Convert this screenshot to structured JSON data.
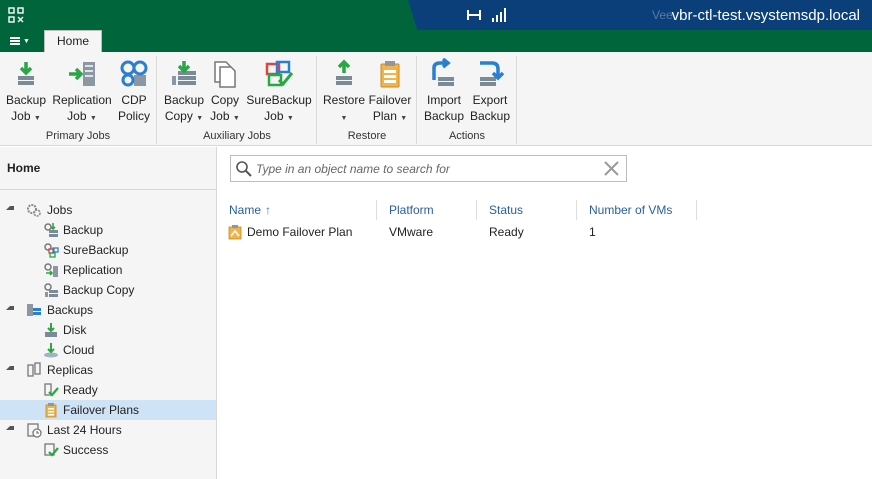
{
  "window": {
    "server_name": "vbr-ctl-test.vsystemsdp.local",
    "ghost_text": "Vee"
  },
  "tabs": {
    "home": "Home"
  },
  "ribbon": {
    "groups": [
      {
        "label": "Primary Jobs",
        "buttons": [
          {
            "line1": "Backup",
            "line2": "Job",
            "dropdown": true,
            "icon": "backup-job-icon"
          },
          {
            "line1": "Replication",
            "line2": "Job",
            "dropdown": true,
            "icon": "replication-job-icon"
          },
          {
            "line1": "CDP",
            "line2": "Policy",
            "dropdown": false,
            "icon": "cdp-policy-icon"
          }
        ]
      },
      {
        "label": "Auxiliary Jobs",
        "buttons": [
          {
            "line1": "Backup",
            "line2": "Copy",
            "dropdown": true,
            "icon": "backup-copy-icon"
          },
          {
            "line1": "Copy",
            "line2": "Job",
            "dropdown": true,
            "icon": "copy-job-icon"
          },
          {
            "line1": "SureBackup",
            "line2": "Job",
            "dropdown": true,
            "icon": "surebackup-job-icon"
          }
        ]
      },
      {
        "label": "Restore",
        "buttons": [
          {
            "line1": "Restore",
            "line2": "",
            "dropdown": true,
            "icon": "restore-icon"
          },
          {
            "line1": "Failover",
            "line2": "Plan",
            "dropdown": true,
            "icon": "failover-plan-icon"
          }
        ]
      },
      {
        "label": "Actions",
        "buttons": [
          {
            "line1": "Import",
            "line2": "Backup",
            "dropdown": false,
            "icon": "import-backup-icon"
          },
          {
            "line1": "Export",
            "line2": "Backup",
            "dropdown": false,
            "icon": "export-backup-icon"
          }
        ]
      }
    ]
  },
  "sidebar": {
    "title": "Home",
    "tree": [
      {
        "label": "Jobs",
        "level": 0,
        "icon": "jobs-icon"
      },
      {
        "label": "Backup",
        "level": 1,
        "icon": "backup-job-tree-icon"
      },
      {
        "label": "SureBackup",
        "level": 1,
        "icon": "surebackup-tree-icon"
      },
      {
        "label": "Replication",
        "level": 1,
        "icon": "replication-tree-icon"
      },
      {
        "label": "Backup Copy",
        "level": 1,
        "icon": "backup-copy-tree-icon"
      },
      {
        "label": "Backups",
        "level": 0,
        "icon": "backups-icon"
      },
      {
        "label": "Disk",
        "level": 1,
        "icon": "disk-icon"
      },
      {
        "label": "Cloud",
        "level": 1,
        "icon": "cloud-icon"
      },
      {
        "label": "Replicas",
        "level": 0,
        "icon": "replicas-icon"
      },
      {
        "label": "Ready",
        "level": 1,
        "icon": "ready-icon"
      },
      {
        "label": "Failover Plans",
        "level": 1,
        "icon": "failover-plans-icon",
        "selected": true
      },
      {
        "label": "Last 24 Hours",
        "level": 0,
        "icon": "last-24-hours-icon"
      },
      {
        "label": "Success",
        "level": 1,
        "icon": "success-icon"
      }
    ]
  },
  "search": {
    "placeholder": "Type in an object name to search for"
  },
  "table": {
    "columns": [
      "Name",
      "Platform",
      "Status",
      "Number of VMs"
    ],
    "sort_column": "Name",
    "rows": [
      {
        "name": "Demo Failover Plan",
        "platform": "VMware",
        "status": "Ready",
        "vms": "1"
      }
    ]
  },
  "colors": {
    "brand_green": "#00653a",
    "server_panel": "#0b3f7a",
    "selection": "#cfe3f7",
    "header_text": "#2a5f9e"
  }
}
